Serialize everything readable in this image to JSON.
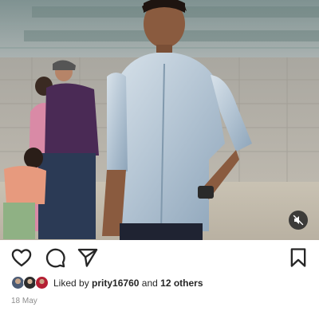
{
  "post": {
    "image_description_icon": "photo-of-person",
    "mute_icon": "speaker-muted-icon"
  },
  "actions": {
    "like_icon": "heart-outline-icon",
    "comment_icon": "comment-bubble-icon",
    "share_icon": "paper-plane-icon",
    "save_icon": "bookmark-outline-icon"
  },
  "likes": {
    "prefix": "Liked by",
    "username": "prity16760",
    "connector": "and",
    "others": "12 others"
  },
  "date": "18 May"
}
